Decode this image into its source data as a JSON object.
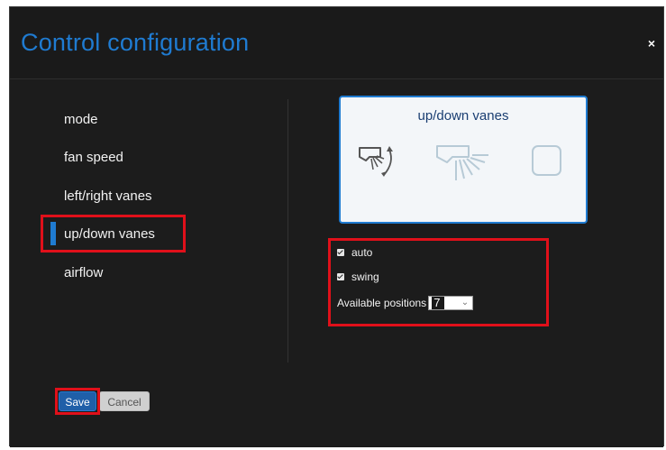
{
  "dialog": {
    "title": "Control configuration",
    "close_label": "×"
  },
  "nav": {
    "items": [
      {
        "label": "mode",
        "active": false
      },
      {
        "label": "fan speed",
        "active": false
      },
      {
        "label": "left/right vanes",
        "active": false
      },
      {
        "label": "up/down vanes",
        "active": true
      },
      {
        "label": "airflow",
        "active": false
      }
    ]
  },
  "preview": {
    "title": "up/down vanes",
    "icons": [
      "vane-auto-icon",
      "vane-swing-icon",
      "vane-empty-icon"
    ]
  },
  "options": {
    "auto_label": "auto",
    "auto_checked": true,
    "swing_label": "swing",
    "swing_checked": true,
    "positions_label": "Available positions",
    "positions_value": "7"
  },
  "footer": {
    "save_label": "Save",
    "cancel_label": "Cancel"
  },
  "colors": {
    "accent": "#1f7bd1",
    "highlight": "#e0101a",
    "dialog_bg": "#1f1f1f"
  }
}
